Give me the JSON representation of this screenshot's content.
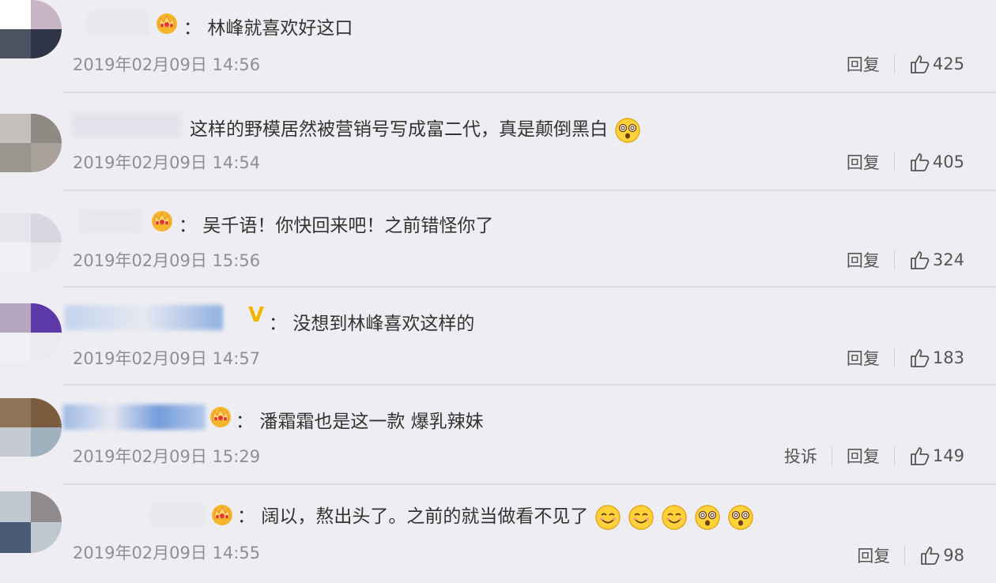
{
  "comments": [
    {
      "text": "林峰就喜欢好这口",
      "time": "2019年02月09日 14:56",
      "reply": "回复",
      "likes": "425",
      "badge": "crown-icon"
    },
    {
      "text": "这样的野模居然被营销号写成富二代，真是颠倒黑白",
      "time": "2019年02月09日 14:54",
      "reply": "回复",
      "likes": "405",
      "badge": "none"
    },
    {
      "text": "吴千语！你快回来吧！之前错怪你了",
      "time": "2019年02月09日 15:56",
      "reply": "回复",
      "likes": "324",
      "badge": "crown-icon"
    },
    {
      "text": "没想到林峰喜欢这样的",
      "time": "2019年02月09日 14:57",
      "reply": "回复",
      "likes": "183",
      "badge": "v-icon"
    },
    {
      "text": "潘霜霜也是这一款 爆乳辣妹",
      "time": "2019年02月09日 15:29",
      "reply": "回复",
      "report": "投诉",
      "likes": "149",
      "badge": "crown-icon"
    },
    {
      "text": "阔以，熬出头了。之前的就当做看不见了",
      "time": "2019年02月09日 14:55",
      "reply": "回复",
      "likes": "98",
      "badge": "crown-icon"
    }
  ],
  "colon": "："
}
